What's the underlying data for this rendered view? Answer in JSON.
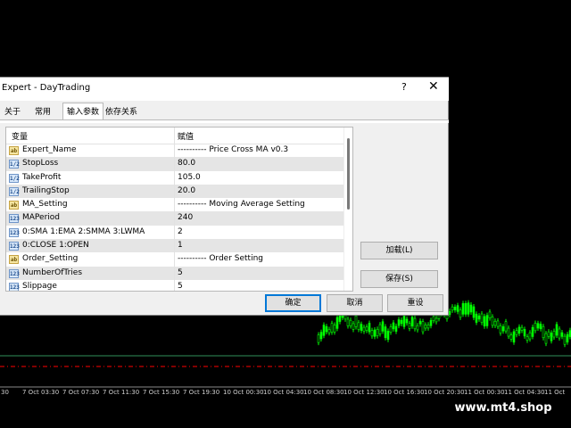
{
  "chart": {
    "candle_color": "#00ff00",
    "level_line_color": "#2f8f5a",
    "dashed_line_color": "#ff0000",
    "time_labels": [
      "30",
      "7 Oct 03:30",
      "7 Oct 07:30",
      "7 Oct 11:30",
      "7 Oct 15:30",
      "7 Oct 19:30",
      "10 Oct 00:30",
      "10 Oct 04:30",
      "10 Oct 08:30",
      "10 Oct 12:30",
      "10 Oct 16:30",
      "10 Oct 20:30",
      "11 Oct 00:30",
      "11 Oct 04:30",
      "11 Oct"
    ],
    "watermark": "www.mt4.shop"
  },
  "dialog": {
    "title": "Expert - DayTrading",
    "help_glyph": "?",
    "close_glyph": "✕",
    "tabs": [
      {
        "label": "关于",
        "active": false
      },
      {
        "label": "常用",
        "active": false
      },
      {
        "label": "输入参数",
        "active": true
      },
      {
        "label": "依存关系",
        "active": false
      }
    ],
    "table": {
      "col_variable": "变量",
      "col_value": "赋值",
      "rows": [
        {
          "icon": "ab",
          "icon_text": "ab",
          "name": "Expert_Name",
          "value": "---------- Price Cross MA v0.3"
        },
        {
          "icon": "num",
          "icon_text": "1/2",
          "name": "StopLoss",
          "value": "80.0"
        },
        {
          "icon": "num",
          "icon_text": "1/2",
          "name": "TakeProfit",
          "value": "105.0"
        },
        {
          "icon": "num",
          "icon_text": "1/2",
          "name": "TrailingStop",
          "value": "20.0"
        },
        {
          "icon": "ab",
          "icon_text": "ab",
          "name": "MA_Setting",
          "value": "---------- Moving Average Setting"
        },
        {
          "icon": "num",
          "icon_text": "123",
          "name": "MAPeriod",
          "value": "240"
        },
        {
          "icon": "num",
          "icon_text": "123",
          "name": "0:SMA 1:EMA 2:SMMA 3:LWMA",
          "value": "2"
        },
        {
          "icon": "num",
          "icon_text": "123",
          "name": "0:CLOSE 1:OPEN",
          "value": "1"
        },
        {
          "icon": "ab",
          "icon_text": "ab",
          "name": "Order_Setting",
          "value": "---------- Order Setting"
        },
        {
          "icon": "num",
          "icon_text": "123",
          "name": "NumberOfTries",
          "value": "5"
        },
        {
          "icon": "num",
          "icon_text": "123",
          "name": "Slippage",
          "value": "5"
        }
      ]
    },
    "buttons": {
      "load": "加载(L)",
      "save": "保存(S)",
      "ok": "确定",
      "cancel": "取消",
      "reset": "重设"
    }
  }
}
